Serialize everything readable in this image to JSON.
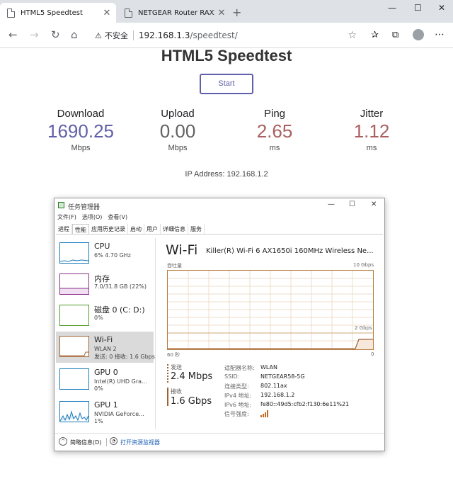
{
  "browser": {
    "tabs": [
      {
        "title": "HTML5 Speedtest",
        "active": true
      },
      {
        "title": "NETGEAR Router RAX120",
        "active": false
      }
    ],
    "new_tab": "+",
    "window_controls": {
      "minimize": "—",
      "maximize": "☐",
      "close": "✕"
    },
    "toolbar": {
      "back": "←",
      "forward": "→",
      "reload": "↻",
      "home": "⌂",
      "warning": "⚠",
      "insecure_label": "不安全",
      "url_host": "192.168.1.3",
      "url_path": "/speedtest/",
      "star": "☆",
      "favorites": "✰",
      "collections": "⧉",
      "menu": "⋯"
    }
  },
  "speedtest": {
    "title": "HTML5 Speedtest",
    "start_label": "Start",
    "metrics": [
      {
        "label": "Download",
        "value": "1690.25",
        "unit": "Mbps",
        "color": "#6060AA"
      },
      {
        "label": "Upload",
        "value": "0.00",
        "unit": "Mbps",
        "color": "#616161"
      },
      {
        "label": "Ping",
        "value": "2.65",
        "unit": "ms",
        "color": "#AA6060"
      },
      {
        "label": "Jitter",
        "value": "1.12",
        "unit": "ms",
        "color": "#AA6060"
      }
    ],
    "ip_label": "IP Address:",
    "ip_value": "192.168.1.2",
    "ip_text": "IP Address: 192.168.1.2"
  },
  "task_manager": {
    "title": "任务管理器",
    "controls": {
      "minimize": "—",
      "maximize": "☐",
      "close": "✕"
    },
    "menu": [
      "文件(F)",
      "选项(O)",
      "查看(V)"
    ],
    "tabs": [
      "进程",
      "性能",
      "应用历史记录",
      "启动",
      "用户",
      "详细信息",
      "服务"
    ],
    "selected_tab": "性能",
    "resources": [
      {
        "name": "CPU",
        "sub1": "6% 4.70 GHz",
        "sub2": "",
        "color": "#1779ba"
      },
      {
        "name": "内存",
        "sub1": "7.0/31.8 GB (22%)",
        "sub2": "",
        "color": "#8b2f8b"
      },
      {
        "name": "磁盘 0 (C: D:)",
        "sub1": "0%",
        "sub2": "",
        "color": "#4d9a26"
      },
      {
        "name": "Wi-Fi",
        "sub1": "WLAN 2",
        "sub2": "发送: 0 接收: 1.6 Gbps",
        "color": "#a26230"
      },
      {
        "name": "GPU 0",
        "sub1": "Intel(R) UHD Gra...",
        "sub2": "0%",
        "color": "#1779ba"
      },
      {
        "name": "GPU 1",
        "sub1": "NVIDIA GeForce...",
        "sub2": "1%",
        "color": "#1779ba"
      }
    ],
    "detail": {
      "title": "Wi-Fi",
      "adapter": "Killer(R) Wi-Fi 6 AX1650i 160MHz Wireless Ne...",
      "throughput_label": "吞吐量",
      "max_label": "10 Gbps",
      "mid_label": "2 Gbps",
      "time_label": "60 秒",
      "zero_label": "0",
      "send_label": "发送",
      "send_value": "2.4 Mbps",
      "recv_label": "接收",
      "recv_value": "1.6 Gbps",
      "info": [
        {
          "key": "适配器名称:",
          "value": "WLAN"
        },
        {
          "key": "SSID:",
          "value": "NETGEAR58-5G"
        },
        {
          "key": "连接类型:",
          "value": "802.11ax"
        },
        {
          "key": "IPv4 地址:",
          "value": "192.168.1.2"
        },
        {
          "key": "IPv6 地址:",
          "value": "fe80::49d5:cfb2:f130:6e11%21"
        },
        {
          "key": "信号强度:",
          "value": ""
        }
      ],
      "signal_bars": 4
    },
    "footer": {
      "fewer_details": "简略信息(D)",
      "open_monitor": "打开资源监视器"
    }
  }
}
